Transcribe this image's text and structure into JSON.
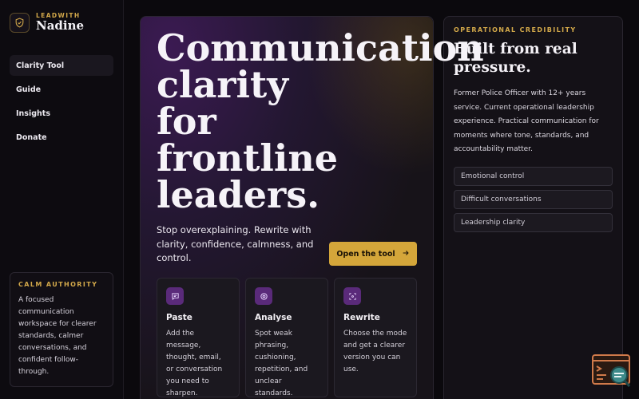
{
  "brand": {
    "eyebrow": "LEADWITH",
    "name": "Nadine"
  },
  "nav": [
    {
      "label": "Clarity Tool",
      "active": true
    },
    {
      "label": "Guide"
    },
    {
      "label": "Insights"
    },
    {
      "label": "Donate"
    }
  ],
  "calm": {
    "heading": "CALM AUTHORITY",
    "text": "A focused communication workspace for clearer standards, calmer conversations, and confident follow-through."
  },
  "hero": {
    "headline": [
      "Communication",
      "clarity",
      "for",
      "frontline",
      "leaders."
    ],
    "subtext": "Stop overexplaining. Rewrite with clarity, confidence, calmness, and control.",
    "cta_label": "Open the tool",
    "cta_icon": "arrow-right-icon"
  },
  "steps": [
    {
      "icon": "message-icon",
      "title": "Paste",
      "text": "Add the message, thought, email, or conversation you need to sharpen."
    },
    {
      "icon": "target-icon",
      "title": "Analyse",
      "text": "Spot weak phrasing, cushioning, repetition, and unclear standards."
    },
    {
      "icon": "focus-icon",
      "title": "Rewrite",
      "text": "Choose the mode and get a clearer version you can use."
    }
  ],
  "credibility": {
    "eyebrow": "OPERATIONAL CREDIBILITY",
    "title": "Built from real pressure.",
    "body": "Former Police Officer with 12+ years service. Current operational leadership experience. Practical communication for moments where tone, standards, and accountability matter.",
    "tags": [
      "Emotional control",
      "Difficult conversations",
      "Leadership clarity"
    ]
  },
  "colors": {
    "accent": "#d4a63a",
    "purple": "#5a2a7a",
    "background": "#0b090d"
  }
}
